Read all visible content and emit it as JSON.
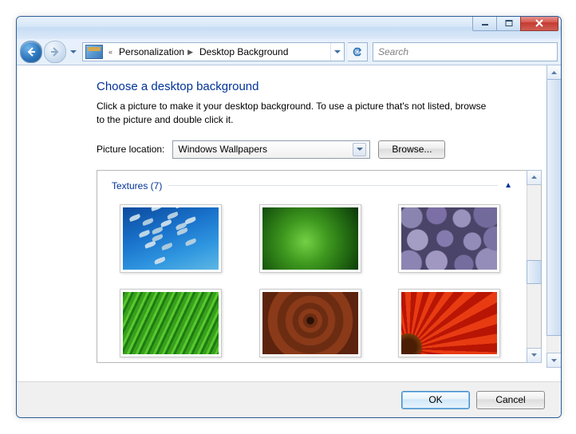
{
  "titlebar": {},
  "nav": {
    "breadcrumb": {
      "level1": "Personalization",
      "level2": "Desktop Background"
    },
    "search_placeholder": "Search"
  },
  "page": {
    "heading": "Choose a desktop background",
    "description": "Click a picture to make it your desktop background. To use a picture that's not listed, browse to the picture and double click it.",
    "location_label": "Picture location:",
    "location_value": "Windows Wallpapers",
    "browse_label": "Browse...",
    "group_label": "Textures (7)"
  },
  "footer": {
    "ok": "OK",
    "cancel": "Cancel"
  }
}
